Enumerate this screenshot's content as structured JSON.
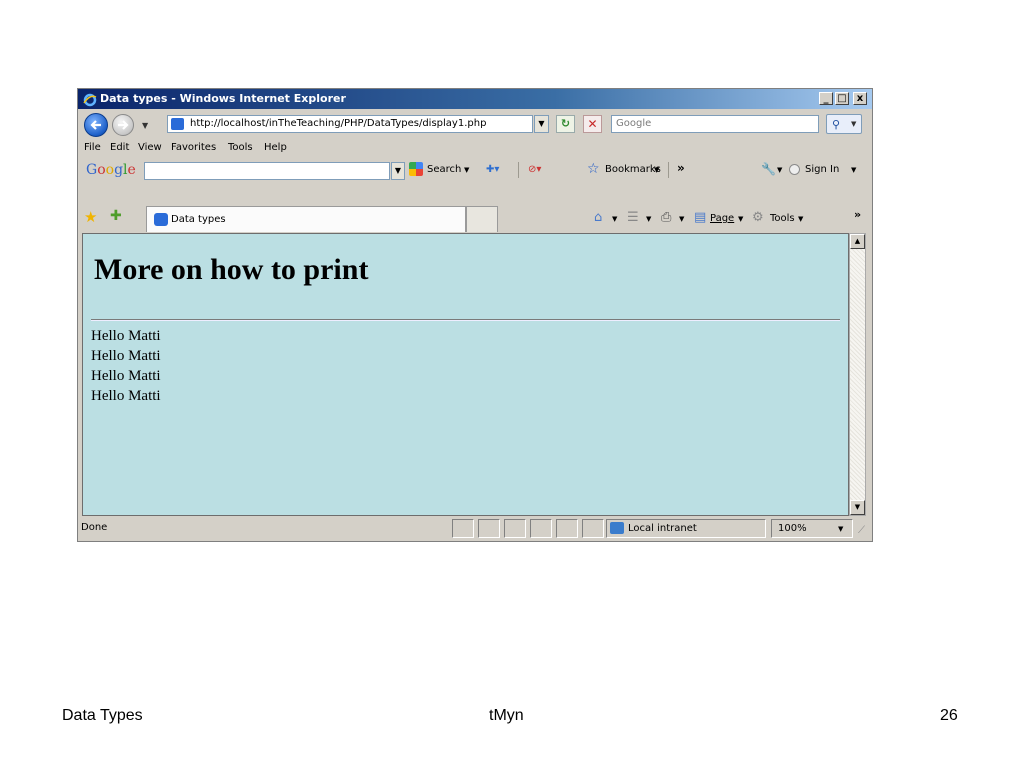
{
  "window": {
    "title": "Data types - Windows Internet Explorer",
    "caption_buttons": [
      "_",
      "□",
      "x"
    ]
  },
  "address_bar": {
    "url": "http://localhost/inTheTeaching/PHP/DataTypes/display1.php",
    "search_placeholder": "Google"
  },
  "menu": {
    "items": [
      "File",
      "Edit",
      "View",
      "Favorites",
      "Tools",
      "Help"
    ]
  },
  "google_toolbar": {
    "logo": "Google",
    "search_label": "Search",
    "bookmarks_label": "Bookmarks",
    "more": "»",
    "signin_label": "Sign In"
  },
  "tabs": {
    "active_tab_label": "Data types"
  },
  "command_bar": {
    "page_label": "Page",
    "tools_label": "Tools",
    "more": "»"
  },
  "page": {
    "heading": "More on how to print",
    "lines": [
      "Hello Matti",
      "Hello Matti",
      "Hello Matti",
      "Hello Matti"
    ]
  },
  "status_bar": {
    "status": "Done",
    "zone": "Local intranet",
    "zoom": "100%"
  },
  "slide_footer": {
    "left": "Data Types",
    "center": "tMyn",
    "right": "26"
  },
  "colors": {
    "page_background": "#bbdfe3",
    "titlebar_start": "#0a246a",
    "chrome": "#d4d0c8"
  }
}
